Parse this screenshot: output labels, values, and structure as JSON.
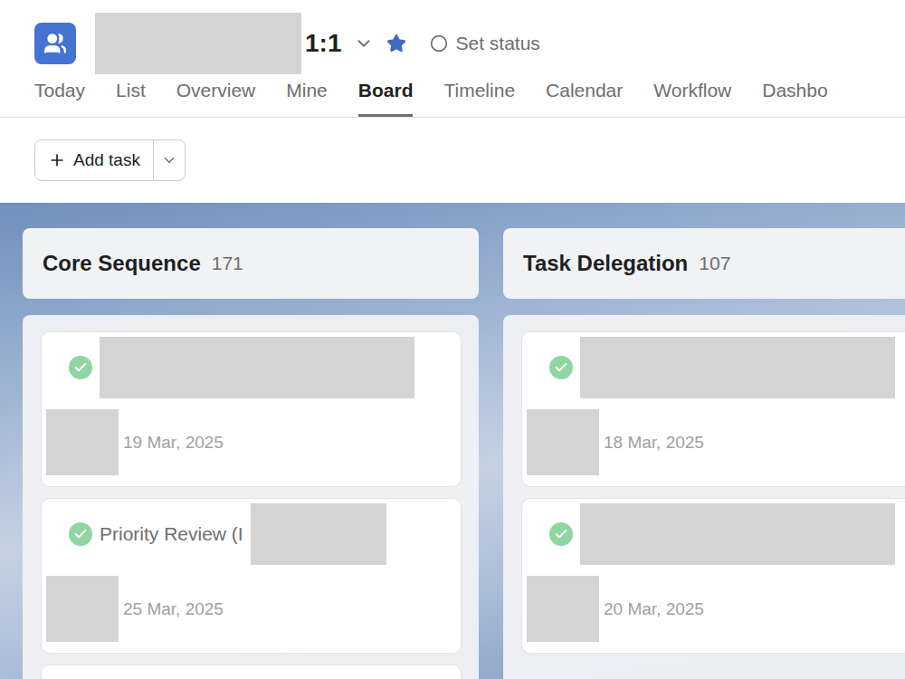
{
  "project": {
    "title": "1:1",
    "title_redacted": true,
    "starred": true,
    "status": "Set status"
  },
  "tabs": [
    {
      "label": "Today",
      "selected": false
    },
    {
      "label": "List",
      "selected": false
    },
    {
      "label": "Overview",
      "selected": false
    },
    {
      "label": "Mine",
      "selected": false
    },
    {
      "label": "Board",
      "selected": true
    },
    {
      "label": "Timeline",
      "selected": false
    },
    {
      "label": "Calendar",
      "selected": false
    },
    {
      "label": "Workflow",
      "selected": false
    },
    {
      "label": "Dashbo",
      "selected": false
    }
  ],
  "toolbar": {
    "add_button": "Add task"
  },
  "columns": [
    {
      "name": "Core Sequence",
      "count": "171",
      "cards": [
        {
          "kind": "task",
          "completed": true,
          "title": "",
          "title_redacted": true,
          "assignee_redacted": true,
          "date": "19 Mar, 2025"
        },
        {
          "kind": "task",
          "completed": true,
          "title": "Priority Review (I",
          "title_redacted": true,
          "assignee_redacted": true,
          "date": "25 Mar, 2025"
        },
        {
          "kind": "stub"
        }
      ]
    },
    {
      "name": "Task Delegation",
      "count": "107",
      "cards": [
        {
          "kind": "task",
          "completed": true,
          "title": "",
          "title_redacted": true,
          "assignee_redacted": true,
          "date": "18 Mar, 2025"
        },
        {
          "kind": "task",
          "completed": true,
          "title": "",
          "title_redacted": true,
          "assignee_redacted": true,
          "date": "20 Mar, 2025"
        }
      ]
    }
  ]
}
